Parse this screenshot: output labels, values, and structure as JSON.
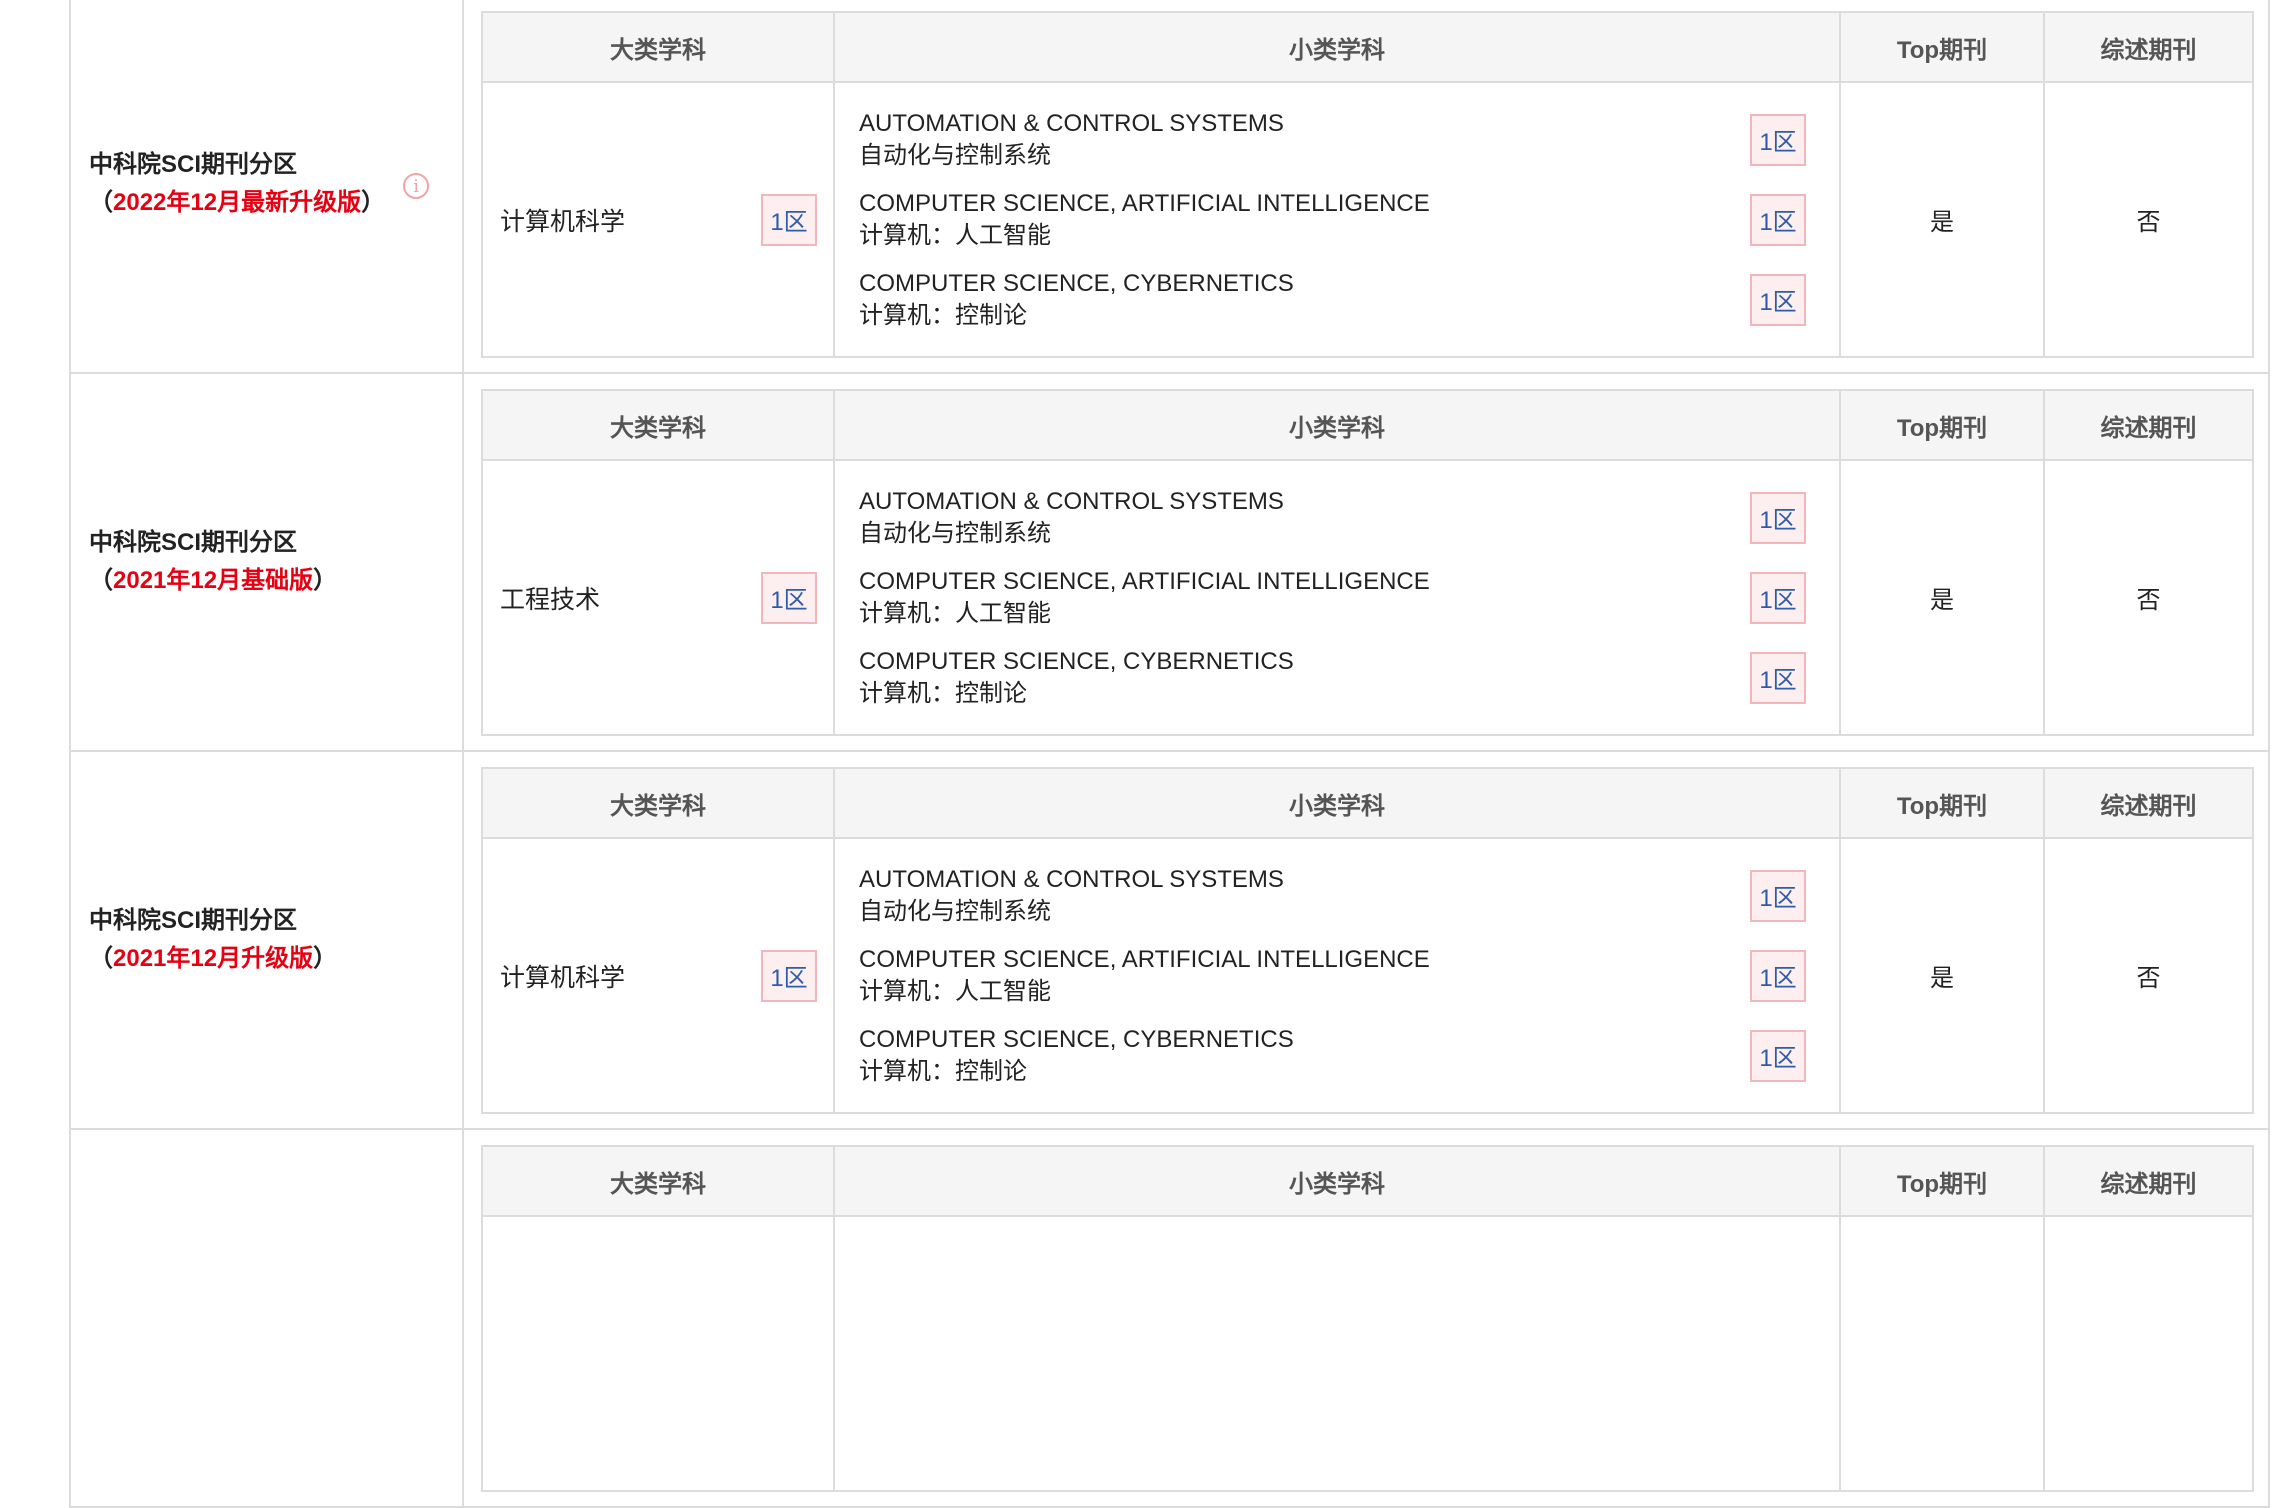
{
  "headers": {
    "major": "大类学科",
    "minor": "小类学科",
    "top": "Top期刊",
    "review": "综述期刊"
  },
  "info_icon": "info-icon",
  "colors": {
    "version_red": "#e60012",
    "zone_text": "#2d5cab",
    "zone_bg": "#fdeeef",
    "zone_border": "#f2b6bb",
    "border": "#dcdcdc",
    "header_bg": "#f5f5f5"
  },
  "rows": [
    {
      "title": "中科院SCI期刊分区",
      "paren_open": "（",
      "version": "2022年12月最新升级版",
      "paren_close": "）",
      "major": {
        "name": "计算机科学",
        "zone": "1区"
      },
      "minors": [
        {
          "en": "AUTOMATION & CONTROL SYSTEMS",
          "cn": "自动化与控制系统",
          "zone": "1区"
        },
        {
          "en": "COMPUTER SCIENCE, ARTIFICIAL INTELLIGENCE",
          "cn": "计算机：人工智能",
          "zone": "1区"
        },
        {
          "en": "COMPUTER SCIENCE, CYBERNETICS",
          "cn": "计算机：控制论",
          "zone": "1区"
        }
      ],
      "top": "是",
      "review": "否"
    },
    {
      "title": "中科院SCI期刊分区",
      "paren_open": "（",
      "version": "2021年12月基础版",
      "paren_close": "）",
      "major": {
        "name": "工程技术",
        "zone": "1区"
      },
      "minors": [
        {
          "en": "AUTOMATION & CONTROL SYSTEMS",
          "cn": "自动化与控制系统",
          "zone": "1区"
        },
        {
          "en": "COMPUTER SCIENCE, ARTIFICIAL INTELLIGENCE",
          "cn": "计算机：人工智能",
          "zone": "1区"
        },
        {
          "en": "COMPUTER SCIENCE, CYBERNETICS",
          "cn": "计算机：控制论",
          "zone": "1区"
        }
      ],
      "top": "是",
      "review": "否"
    },
    {
      "title": "中科院SCI期刊分区",
      "paren_open": "（",
      "version": "2021年12月升级版",
      "paren_close": "）",
      "major": {
        "name": "计算机科学",
        "zone": "1区"
      },
      "minors": [
        {
          "en": "AUTOMATION & CONTROL SYSTEMS",
          "cn": "自动化与控制系统",
          "zone": "1区"
        },
        {
          "en": "COMPUTER SCIENCE, ARTIFICIAL INTELLIGENCE",
          "cn": "计算机：人工智能",
          "zone": "1区"
        },
        {
          "en": "COMPUTER SCIENCE, CYBERNETICS",
          "cn": "计算机：控制论",
          "zone": "1区"
        }
      ],
      "top": "是",
      "review": "否"
    }
  ]
}
